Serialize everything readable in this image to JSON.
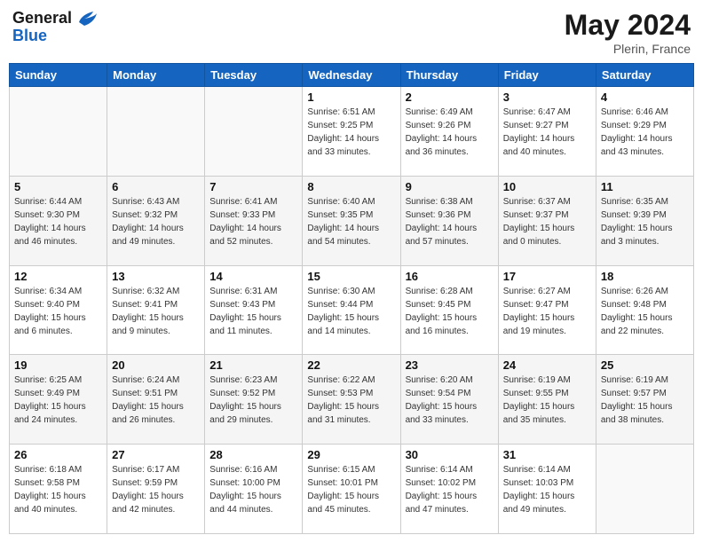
{
  "header": {
    "logo_line1": "General",
    "logo_line2": "Blue",
    "month_year": "May 2024",
    "location": "Plerin, France"
  },
  "days_of_week": [
    "Sunday",
    "Monday",
    "Tuesday",
    "Wednesday",
    "Thursday",
    "Friday",
    "Saturday"
  ],
  "weeks": [
    [
      {
        "day": "",
        "sunrise": "",
        "sunset": "",
        "daylight": ""
      },
      {
        "day": "",
        "sunrise": "",
        "sunset": "",
        "daylight": ""
      },
      {
        "day": "",
        "sunrise": "",
        "sunset": "",
        "daylight": ""
      },
      {
        "day": "1",
        "sunrise": "Sunrise: 6:51 AM",
        "sunset": "Sunset: 9:25 PM",
        "daylight": "Daylight: 14 hours and 33 minutes."
      },
      {
        "day": "2",
        "sunrise": "Sunrise: 6:49 AM",
        "sunset": "Sunset: 9:26 PM",
        "daylight": "Daylight: 14 hours and 36 minutes."
      },
      {
        "day": "3",
        "sunrise": "Sunrise: 6:47 AM",
        "sunset": "Sunset: 9:27 PM",
        "daylight": "Daylight: 14 hours and 40 minutes."
      },
      {
        "day": "4",
        "sunrise": "Sunrise: 6:46 AM",
        "sunset": "Sunset: 9:29 PM",
        "daylight": "Daylight: 14 hours and 43 minutes."
      }
    ],
    [
      {
        "day": "5",
        "sunrise": "Sunrise: 6:44 AM",
        "sunset": "Sunset: 9:30 PM",
        "daylight": "Daylight: 14 hours and 46 minutes."
      },
      {
        "day": "6",
        "sunrise": "Sunrise: 6:43 AM",
        "sunset": "Sunset: 9:32 PM",
        "daylight": "Daylight: 14 hours and 49 minutes."
      },
      {
        "day": "7",
        "sunrise": "Sunrise: 6:41 AM",
        "sunset": "Sunset: 9:33 PM",
        "daylight": "Daylight: 14 hours and 52 minutes."
      },
      {
        "day": "8",
        "sunrise": "Sunrise: 6:40 AM",
        "sunset": "Sunset: 9:35 PM",
        "daylight": "Daylight: 14 hours and 54 minutes."
      },
      {
        "day": "9",
        "sunrise": "Sunrise: 6:38 AM",
        "sunset": "Sunset: 9:36 PM",
        "daylight": "Daylight: 14 hours and 57 minutes."
      },
      {
        "day": "10",
        "sunrise": "Sunrise: 6:37 AM",
        "sunset": "Sunset: 9:37 PM",
        "daylight": "Daylight: 15 hours and 0 minutes."
      },
      {
        "day": "11",
        "sunrise": "Sunrise: 6:35 AM",
        "sunset": "Sunset: 9:39 PM",
        "daylight": "Daylight: 15 hours and 3 minutes."
      }
    ],
    [
      {
        "day": "12",
        "sunrise": "Sunrise: 6:34 AM",
        "sunset": "Sunset: 9:40 PM",
        "daylight": "Daylight: 15 hours and 6 minutes."
      },
      {
        "day": "13",
        "sunrise": "Sunrise: 6:32 AM",
        "sunset": "Sunset: 9:41 PM",
        "daylight": "Daylight: 15 hours and 9 minutes."
      },
      {
        "day": "14",
        "sunrise": "Sunrise: 6:31 AM",
        "sunset": "Sunset: 9:43 PM",
        "daylight": "Daylight: 15 hours and 11 minutes."
      },
      {
        "day": "15",
        "sunrise": "Sunrise: 6:30 AM",
        "sunset": "Sunset: 9:44 PM",
        "daylight": "Daylight: 15 hours and 14 minutes."
      },
      {
        "day": "16",
        "sunrise": "Sunrise: 6:28 AM",
        "sunset": "Sunset: 9:45 PM",
        "daylight": "Daylight: 15 hours and 16 minutes."
      },
      {
        "day": "17",
        "sunrise": "Sunrise: 6:27 AM",
        "sunset": "Sunset: 9:47 PM",
        "daylight": "Daylight: 15 hours and 19 minutes."
      },
      {
        "day": "18",
        "sunrise": "Sunrise: 6:26 AM",
        "sunset": "Sunset: 9:48 PM",
        "daylight": "Daylight: 15 hours and 22 minutes."
      }
    ],
    [
      {
        "day": "19",
        "sunrise": "Sunrise: 6:25 AM",
        "sunset": "Sunset: 9:49 PM",
        "daylight": "Daylight: 15 hours and 24 minutes."
      },
      {
        "day": "20",
        "sunrise": "Sunrise: 6:24 AM",
        "sunset": "Sunset: 9:51 PM",
        "daylight": "Daylight: 15 hours and 26 minutes."
      },
      {
        "day": "21",
        "sunrise": "Sunrise: 6:23 AM",
        "sunset": "Sunset: 9:52 PM",
        "daylight": "Daylight: 15 hours and 29 minutes."
      },
      {
        "day": "22",
        "sunrise": "Sunrise: 6:22 AM",
        "sunset": "Sunset: 9:53 PM",
        "daylight": "Daylight: 15 hours and 31 minutes."
      },
      {
        "day": "23",
        "sunrise": "Sunrise: 6:20 AM",
        "sunset": "Sunset: 9:54 PM",
        "daylight": "Daylight: 15 hours and 33 minutes."
      },
      {
        "day": "24",
        "sunrise": "Sunrise: 6:19 AM",
        "sunset": "Sunset: 9:55 PM",
        "daylight": "Daylight: 15 hours and 35 minutes."
      },
      {
        "day": "25",
        "sunrise": "Sunrise: 6:19 AM",
        "sunset": "Sunset: 9:57 PM",
        "daylight": "Daylight: 15 hours and 38 minutes."
      }
    ],
    [
      {
        "day": "26",
        "sunrise": "Sunrise: 6:18 AM",
        "sunset": "Sunset: 9:58 PM",
        "daylight": "Daylight: 15 hours and 40 minutes."
      },
      {
        "day": "27",
        "sunrise": "Sunrise: 6:17 AM",
        "sunset": "Sunset: 9:59 PM",
        "daylight": "Daylight: 15 hours and 42 minutes."
      },
      {
        "day": "28",
        "sunrise": "Sunrise: 6:16 AM",
        "sunset": "Sunset: 10:00 PM",
        "daylight": "Daylight: 15 hours and 44 minutes."
      },
      {
        "day": "29",
        "sunrise": "Sunrise: 6:15 AM",
        "sunset": "Sunset: 10:01 PM",
        "daylight": "Daylight: 15 hours and 45 minutes."
      },
      {
        "day": "30",
        "sunrise": "Sunrise: 6:14 AM",
        "sunset": "Sunset: 10:02 PM",
        "daylight": "Daylight: 15 hours and 47 minutes."
      },
      {
        "day": "31",
        "sunrise": "Sunrise: 6:14 AM",
        "sunset": "Sunset: 10:03 PM",
        "daylight": "Daylight: 15 hours and 49 minutes."
      },
      {
        "day": "",
        "sunrise": "",
        "sunset": "",
        "daylight": ""
      }
    ]
  ]
}
